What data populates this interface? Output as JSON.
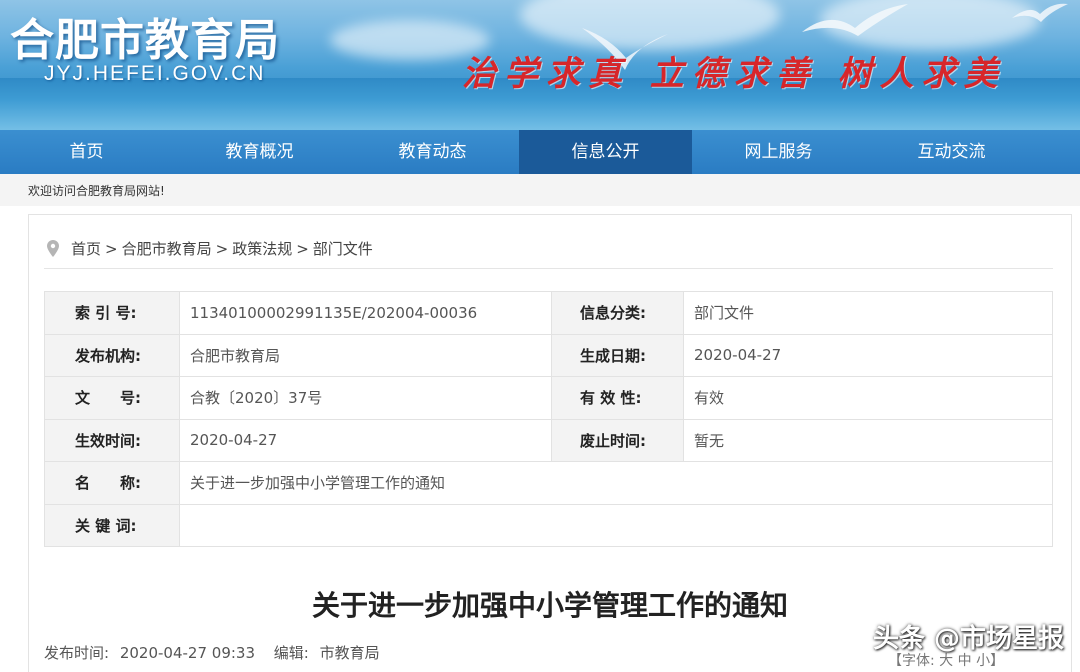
{
  "banner": {
    "site_title": "合肥市教育局",
    "site_domain": "JYJ.HEFEI.GOV.CN",
    "slogan": "治学求真 立德求善 树人求美"
  },
  "nav": {
    "items": [
      {
        "label": "首页"
      },
      {
        "label": "教育概况"
      },
      {
        "label": "教育动态"
      },
      {
        "label": "信息公开",
        "active": true
      },
      {
        "label": "网上服务"
      },
      {
        "label": "互动交流"
      }
    ]
  },
  "welcome_text": "欢迎访问合肥教育局网站!",
  "breadcrumb": {
    "items": [
      "首页",
      "合肥市教育局",
      "政策法规",
      "部门文件"
    ],
    "separator": ">"
  },
  "info_table": {
    "index_label": "索 引 号:",
    "index_value": "11340100002991135E/202004-00036",
    "category_label": "信息分类:",
    "category_value": "部门文件",
    "publisher_label": "发布机构:",
    "publisher_value": "合肥市教育局",
    "created_label": "生成日期:",
    "created_value": "2020-04-27",
    "docno_label": "文　　号:",
    "docno_value": "合教〔2020〕37号",
    "validity_label": "有 效 性:",
    "validity_value": "有效",
    "effective_label": "生效时间:",
    "effective_value": "2020-04-27",
    "abolish_label": "废止时间:",
    "abolish_value": "暂无",
    "name_label": "名　　称:",
    "name_value": "关于进一步加强中小学管理工作的通知",
    "keywords_label": "关 键 词:",
    "keywords_value": ""
  },
  "document": {
    "title": "关于进一步加强中小学管理工作的通知",
    "publish_label": "发布时间:",
    "publish_value": "2020-04-27 09:33",
    "editor_label": "编辑:",
    "editor_value": "市教育局"
  },
  "font_size_control": "【字体: 大 中 小】",
  "watermark": "头条 @市场星报",
  "colors": {
    "nav_bg": "#2a7cc3",
    "nav_active": "#1b5a99",
    "slogan": "#d7262a"
  }
}
